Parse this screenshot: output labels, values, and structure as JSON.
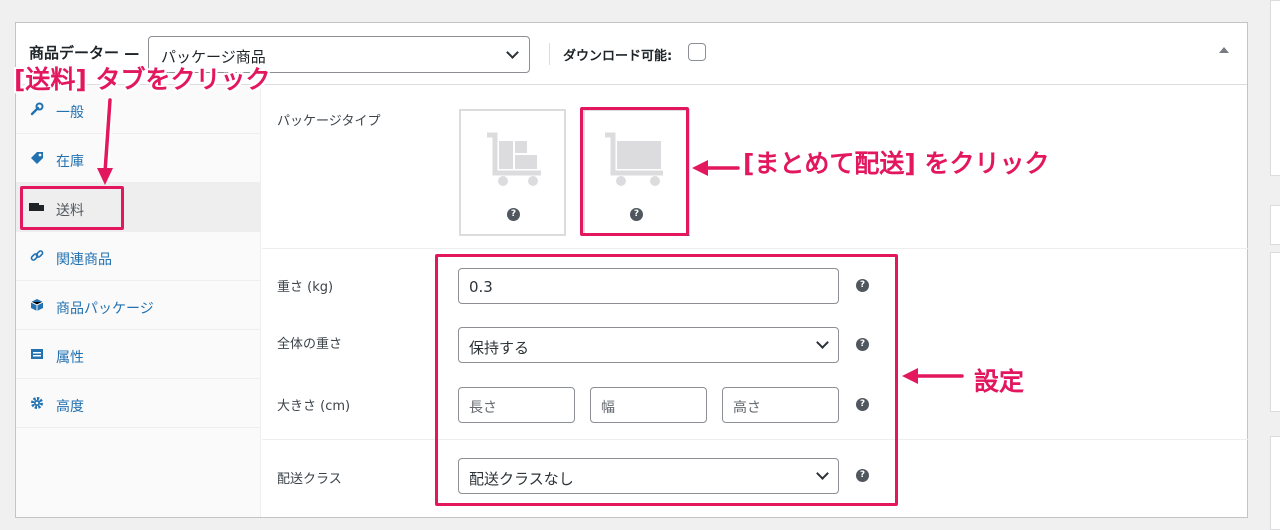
{
  "header": {
    "title": "商品データー —",
    "product_type_value": "パッケージ商品",
    "downloadable_label": "ダウンロード可能:"
  },
  "tabs": [
    {
      "label": "一般",
      "icon": "wrench-icon"
    },
    {
      "label": "在庫",
      "icon": "tag-icon"
    },
    {
      "label": "送料",
      "icon": "truck-icon",
      "active": true
    },
    {
      "label": "関連商品",
      "icon": "link-icon"
    },
    {
      "label": "商品パッケージ",
      "icon": "box-icon"
    },
    {
      "label": "属性",
      "icon": "table-icon"
    },
    {
      "label": "高度",
      "icon": "gear-icon"
    }
  ],
  "shipping": {
    "package_type_label": "パッケージタイプ",
    "weight_label": "重さ (kg)",
    "weight_value": "0.3",
    "total_weight_label": "全体の重さ",
    "total_weight_value": "保持する",
    "dimensions_label": "大きさ (cm)",
    "length_placeholder": "長さ",
    "width_placeholder": "幅",
    "height_placeholder": "高さ",
    "shipping_class_label": "配送クラス",
    "shipping_class_value": "配送クラスなし",
    "help_glyph": "?"
  },
  "annotations": {
    "tab_note": "[送料] タブをクリック",
    "package_note": "[まとめて配送] をクリック",
    "settings_note": "設定",
    "color": "#e2175e"
  }
}
